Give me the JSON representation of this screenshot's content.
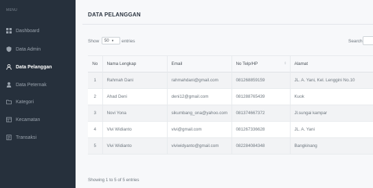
{
  "sidebar": {
    "heading": "MENU",
    "items": [
      {
        "label": "Dashboard",
        "icon": "grid-icon",
        "active": false
      },
      {
        "label": "Data Admin",
        "icon": "shield-icon",
        "active": false
      },
      {
        "label": "Data Pelanggan",
        "icon": "user-icon",
        "active": true
      },
      {
        "label": "Data Peternak",
        "icon": "user-fill-icon",
        "active": false
      },
      {
        "label": "Kategori",
        "icon": "folder-icon",
        "active": false
      },
      {
        "label": "Kecamatan",
        "icon": "map-icon",
        "active": false
      },
      {
        "label": "Transaksi",
        "icon": "receipt-icon",
        "active": false
      }
    ]
  },
  "page": {
    "title": "DATA PELANGGAN"
  },
  "controls": {
    "show_label": "Show",
    "length_value": "50",
    "entries_label": "entries",
    "search_label": "Search:",
    "search_value": ""
  },
  "table": {
    "headers": [
      "No",
      "Nama Lengkap",
      "Email",
      "No Telp/HP",
      "Alamat"
    ],
    "rows": [
      [
        "1",
        "Rahmah Dani",
        "rahmahdani@gmail.com",
        "081268859159",
        "JL. A. Yani, Kel. Lenggini No.10"
      ],
      [
        "2",
        "Ahad Deni",
        "deni12@gmail.com",
        "081288765439",
        "Kuok"
      ],
      [
        "3",
        "Novi Yona",
        "sikumbang_ona@yahoo.com",
        "081374667372",
        "Jl.sungai kampar"
      ],
      [
        "4",
        "Vivi Widianto",
        "vivi@gmail.com",
        "081267336628",
        "JL. A. Yani"
      ],
      [
        "5",
        "Vivi Widianto",
        "viviwidyanto@gmail.com",
        "082284084348",
        "Bangkinang"
      ]
    ]
  },
  "footer": {
    "info": "Showing 1 to 5 of 5 entries"
  },
  "colors": {
    "sidebar_bg": "#26303c",
    "active_text": "#ffffff",
    "stripe": "#f2f3f5"
  }
}
